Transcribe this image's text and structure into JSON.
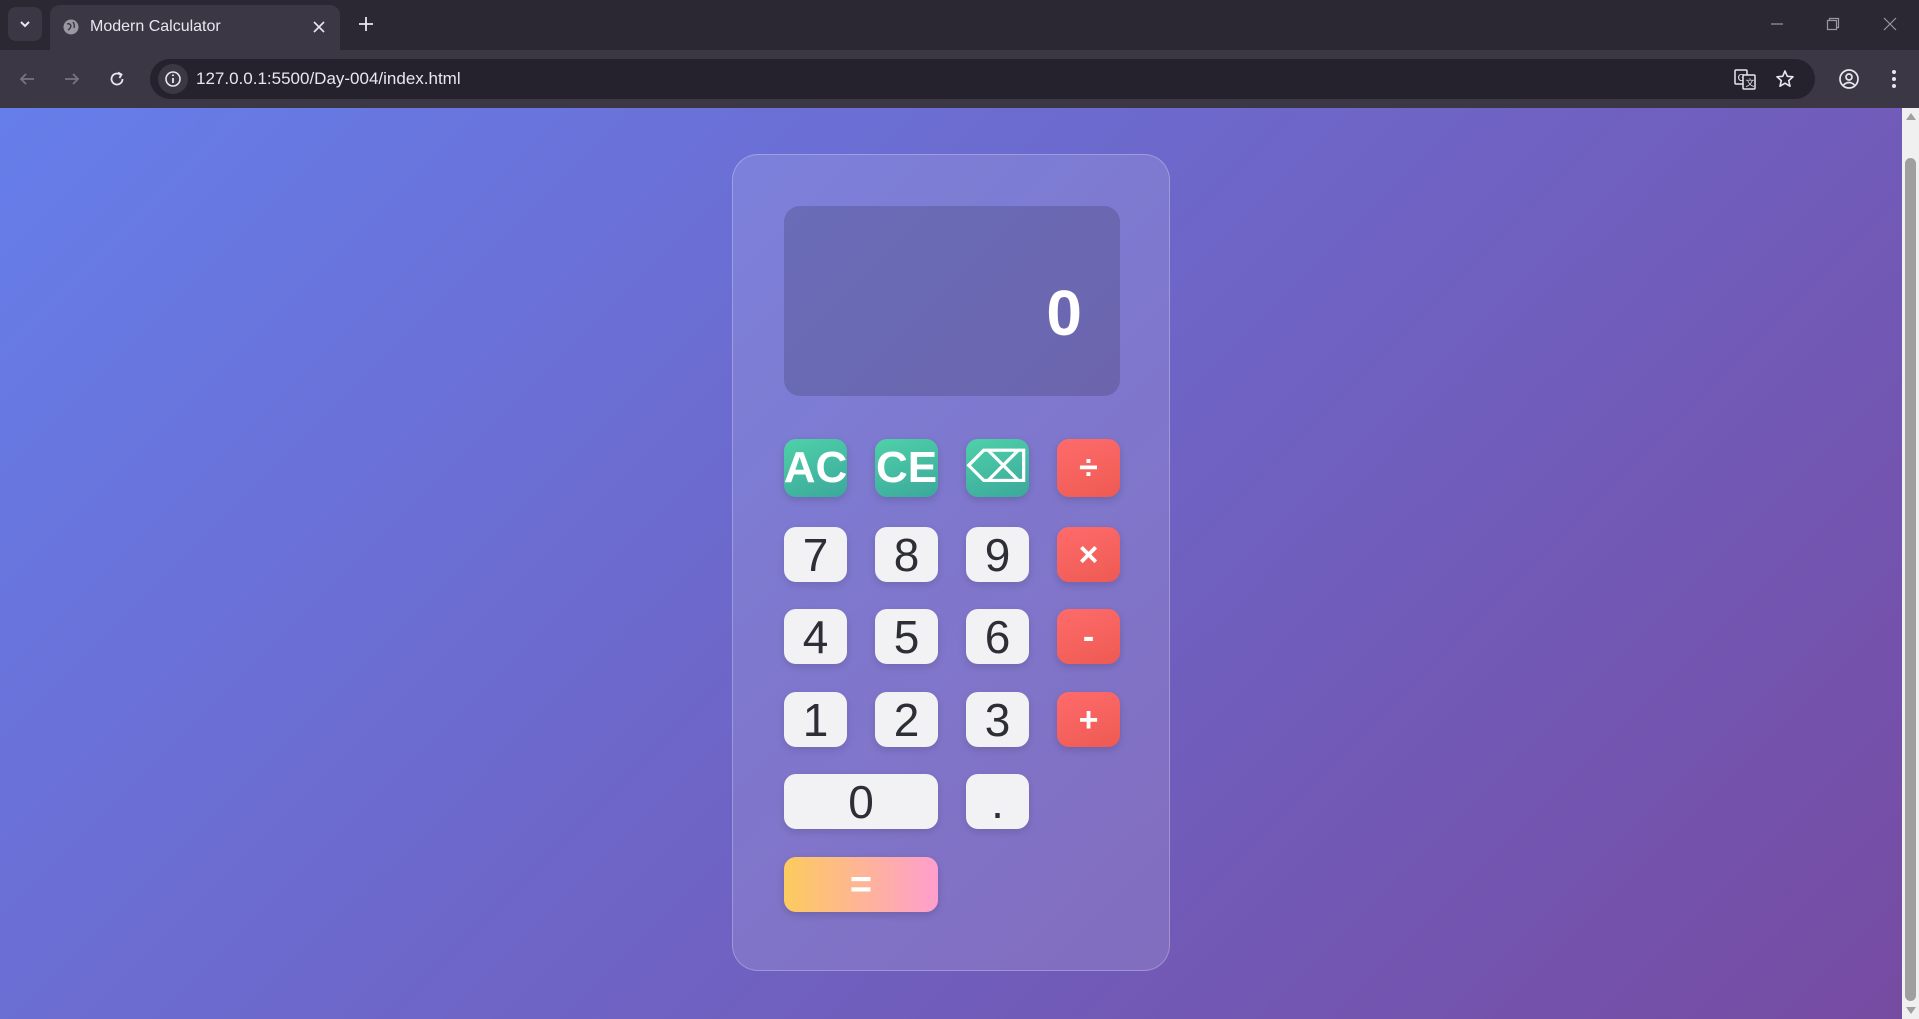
{
  "browser": {
    "tab": {
      "title": "Modern Calculator"
    },
    "address_bar": {
      "url": "127.0.0.1:5500/Day-004/index.html"
    },
    "icons": [
      "tab-search-icon",
      "globe-icon",
      "close-icon",
      "plus-icon",
      "back-arrow-icon",
      "forward-arrow-icon",
      "reload-icon",
      "info-icon",
      "translate-icon",
      "star-icon",
      "profile-icon",
      "menu-icon",
      "minimize-icon",
      "restore-icon",
      "window-close-icon"
    ]
  },
  "calculator": {
    "display": {
      "value": "0"
    },
    "keys": {
      "ac": "AC",
      "ce": "CE",
      "backspace": "⌫",
      "divide": "÷",
      "seven": "7",
      "eight": "8",
      "nine": "9",
      "multiply": "×",
      "four": "4",
      "five": "5",
      "six": "6",
      "subtract": "-",
      "one": "1",
      "two": "2",
      "three": "3",
      "add": "+",
      "zero": "0",
      "decimal": ".",
      "equals": "="
    }
  },
  "colors": {
    "background_gradient": [
      "#667eea",
      "#764ba2"
    ],
    "function_key": "#3fb59f",
    "operator_key": "#f2605c",
    "equals_gradient": [
      "#fccb5e",
      "#ff9ece"
    ],
    "number_key": "#f2f2f5"
  }
}
